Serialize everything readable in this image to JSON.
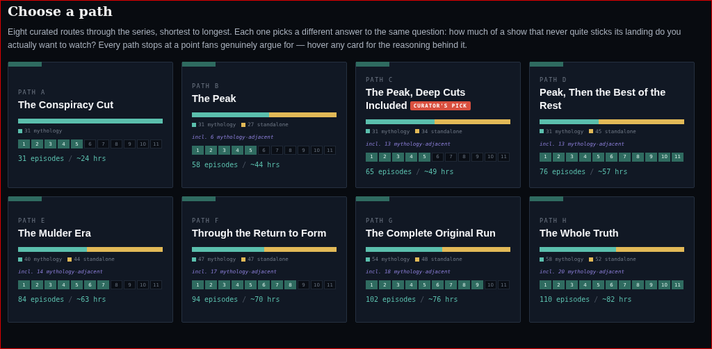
{
  "heading": "Choose a path",
  "intro": "Eight curated routes through the series, shortest to longest. Each one picks a different answer to the same question: how much of a show that never quite sticks its landing do you actually want to watch? Every path stops at a point fans genuinely argue for — hover any card for the reasoning behind it.",
  "paths": [
    {
      "label": "PATH A",
      "title": "The Conspiracy Cut",
      "level": 1,
      "legend": [
        {
          "text": "31 mythology",
          "color": "#5bbfad"
        }
      ],
      "seasons": [
        {
          "label": "1",
          "included": true
        },
        {
          "label": "2",
          "included": true
        },
        {
          "label": "3",
          "included": true
        },
        {
          "label": "4",
          "included": true
        },
        {
          "label": "5",
          "included": true
        },
        {
          "label": "6",
          "included": false
        },
        {
          "label": "7",
          "included": false
        },
        {
          "label": "8",
          "included": false
        },
        {
          "label": "9",
          "included": false
        },
        {
          "label": "10",
          "included": false
        },
        {
          "label": "11",
          "included": false
        }
      ],
      "episodes": "31 episodes",
      "separator": "/",
      "hours": "~24 hrs"
    },
    {
      "label": "PATH B",
      "title": "The Peak",
      "level": 0.534,
      "legend": [
        {
          "text": "31 mythology",
          "color": "#5bbfad"
        },
        {
          "text": "27 standalone",
          "color": "#e2b957"
        }
      ],
      "note": "incl. 6 mythology-adjacent",
      "seasons": [
        {
          "label": "1",
          "included": true
        },
        {
          "label": "2",
          "included": true
        },
        {
          "label": "3",
          "included": true
        },
        {
          "label": "4",
          "included": true
        },
        {
          "label": "5",
          "included": true
        },
        {
          "label": "6",
          "included": false
        },
        {
          "label": "7",
          "included": false
        },
        {
          "label": "8",
          "included": false
        },
        {
          "label": "9",
          "included": false
        },
        {
          "label": "10",
          "included": false
        },
        {
          "label": "11",
          "included": false
        }
      ],
      "episodes": "58 episodes",
      "separator": "/",
      "hours": "~44 hrs"
    },
    {
      "label": "PATH C",
      "title": "The Peak, Deep Cuts Included",
      "badge": "CURATOR'S PICK",
      "level": 0.477,
      "legend": [
        {
          "text": "31 mythology",
          "color": "#5bbfad"
        },
        {
          "text": "34 standalone",
          "color": "#e2b957"
        }
      ],
      "note": "incl. 13 mythology-adjacent",
      "seasons": [
        {
          "label": "1",
          "included": true
        },
        {
          "label": "2",
          "included": true
        },
        {
          "label": "3",
          "included": true
        },
        {
          "label": "4",
          "included": true
        },
        {
          "label": "5",
          "included": true
        },
        {
          "label": "6",
          "included": false
        },
        {
          "label": "7",
          "included": false
        },
        {
          "label": "8",
          "included": false
        },
        {
          "label": "9",
          "included": false
        },
        {
          "label": "10",
          "included": false
        },
        {
          "label": "11",
          "included": false
        }
      ],
      "episodes": "65 episodes",
      "separator": "/",
      "hours": "~49 hrs"
    },
    {
      "label": "PATH D",
      "title": "Peak, Then the Best of the Rest",
      "level": 0.408,
      "legend": [
        {
          "text": "31 mythology",
          "color": "#5bbfad"
        },
        {
          "text": "45 standalone",
          "color": "#e2b957"
        }
      ],
      "note": "incl. 13 mythology-adjacent",
      "seasons": [
        {
          "label": "1",
          "included": true
        },
        {
          "label": "2",
          "included": true
        },
        {
          "label": "3",
          "included": true
        },
        {
          "label": "4",
          "included": true
        },
        {
          "label": "5",
          "included": true
        },
        {
          "label": "6",
          "included": true
        },
        {
          "label": "7",
          "included": true
        },
        {
          "label": "8",
          "included": true
        },
        {
          "label": "9",
          "included": true
        },
        {
          "label": "10",
          "included": true
        },
        {
          "label": "11",
          "included": true
        }
      ],
      "episodes": "76 episodes",
      "separator": "/",
      "hours": "~57 hrs"
    },
    {
      "label": "PATH E",
      "title": "The Mulder Era",
      "level": 0.476,
      "legend": [
        {
          "text": "40 mythology",
          "color": "#5bbfad"
        },
        {
          "text": "44 standalone",
          "color": "#e2b957"
        }
      ],
      "note": "incl. 14 mythology-adjacent",
      "seasons": [
        {
          "label": "1",
          "included": true
        },
        {
          "label": "2",
          "included": true
        },
        {
          "label": "3",
          "included": true
        },
        {
          "label": "4",
          "included": true
        },
        {
          "label": "5",
          "included": true
        },
        {
          "label": "6",
          "included": true
        },
        {
          "label": "7",
          "included": true
        },
        {
          "label": "8",
          "included": false
        },
        {
          "label": "9",
          "included": false
        },
        {
          "label": "10",
          "included": false
        },
        {
          "label": "11",
          "included": false
        }
      ],
      "episodes": "84 episodes",
      "separator": "/",
      "hours": "~63 hrs"
    },
    {
      "label": "PATH F",
      "title": "Through the Return to Form",
      "level": 0.5,
      "legend": [
        {
          "text": "47 mythology",
          "color": "#5bbfad"
        },
        {
          "text": "47 standalone",
          "color": "#e2b957"
        }
      ],
      "note": "incl. 17 mythology-adjacent",
      "seasons": [
        {
          "label": "1",
          "included": true
        },
        {
          "label": "2",
          "included": true
        },
        {
          "label": "3",
          "included": true
        },
        {
          "label": "4",
          "included": true
        },
        {
          "label": "5",
          "included": true
        },
        {
          "label": "6",
          "included": true
        },
        {
          "label": "7",
          "included": true
        },
        {
          "label": "8",
          "included": true
        },
        {
          "label": "9",
          "included": false
        },
        {
          "label": "10",
          "included": false
        },
        {
          "label": "11",
          "included": false
        }
      ],
      "episodes": "94 episodes",
      "separator": "/",
      "hours": "~70 hrs"
    },
    {
      "label": "PATH G",
      "title": "The Complete Original Run",
      "level": 0.529,
      "legend": [
        {
          "text": "54 mythology",
          "color": "#5bbfad"
        },
        {
          "text": "48 standalone",
          "color": "#e2b957"
        }
      ],
      "note": "incl. 18 mythology-adjacent",
      "seasons": [
        {
          "label": "1",
          "included": true
        },
        {
          "label": "2",
          "included": true
        },
        {
          "label": "3",
          "included": true
        },
        {
          "label": "4",
          "included": true
        },
        {
          "label": "5",
          "included": true
        },
        {
          "label": "6",
          "included": true
        },
        {
          "label": "7",
          "included": true
        },
        {
          "label": "8",
          "included": true
        },
        {
          "label": "9",
          "included": true
        },
        {
          "label": "10",
          "included": false
        },
        {
          "label": "11",
          "included": false
        }
      ],
      "episodes": "102 episodes",
      "separator": "/",
      "hours": "~76 hrs"
    },
    {
      "label": "PATH H",
      "title": "The Whole Truth",
      "level": 0.527,
      "legend": [
        {
          "text": "58 mythology",
          "color": "#5bbfad"
        },
        {
          "text": "52 standalone",
          "color": "#e2b957"
        }
      ],
      "note": "incl. 20 mythology-adjacent",
      "seasons": [
        {
          "label": "1",
          "included": true
        },
        {
          "label": "2",
          "included": true
        },
        {
          "label": "3",
          "included": true
        },
        {
          "label": "4",
          "included": true
        },
        {
          "label": "5",
          "included": true
        },
        {
          "label": "6",
          "included": true
        },
        {
          "label": "7",
          "included": true
        },
        {
          "label": "8",
          "included": true
        },
        {
          "label": "9",
          "included": true
        },
        {
          "label": "10",
          "included": true
        },
        {
          "label": "11",
          "included": true
        }
      ],
      "episodes": "110 episodes",
      "separator": "/",
      "hours": "~82 hrs"
    }
  ]
}
